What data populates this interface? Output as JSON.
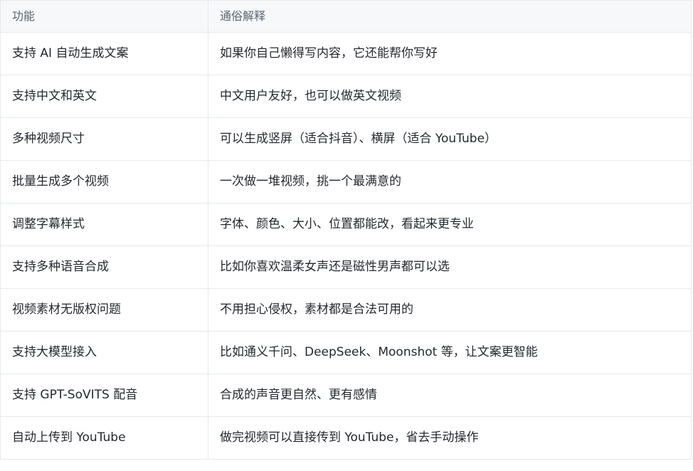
{
  "table": {
    "headers": [
      "功能",
      "通俗解释"
    ],
    "rows": [
      [
        "支持 AI 自动生成文案",
        "如果你自己懒得写内容，它还能帮你写好"
      ],
      [
        "支持中文和英文",
        "中文用户友好，也可以做英文视频"
      ],
      [
        "多种视频尺寸",
        "可以生成竖屏（适合抖音）、横屏（适合 YouTube）"
      ],
      [
        "批量生成多个视频",
        "一次做一堆视频，挑一个最满意的"
      ],
      [
        "调整字幕样式",
        "字体、颜色、大小、位置都能改，看起来更专业"
      ],
      [
        "支持多种语音合成",
        "比如你喜欢温柔女声还是磁性男声都可以选"
      ],
      [
        "视频素材无版权问题",
        "不用担心侵权，素材都是合法可用的"
      ],
      [
        "支持大模型接入",
        "比如通义千问、DeepSeek、Moonshot 等，让文案更智能"
      ],
      [
        "支持 GPT-SoVITS 配音",
        "合成的声音更自然、更有感情"
      ],
      [
        "自动上传到 YouTube",
        "做完视频可以直接传到 YouTube，省去手动操作"
      ]
    ]
  }
}
